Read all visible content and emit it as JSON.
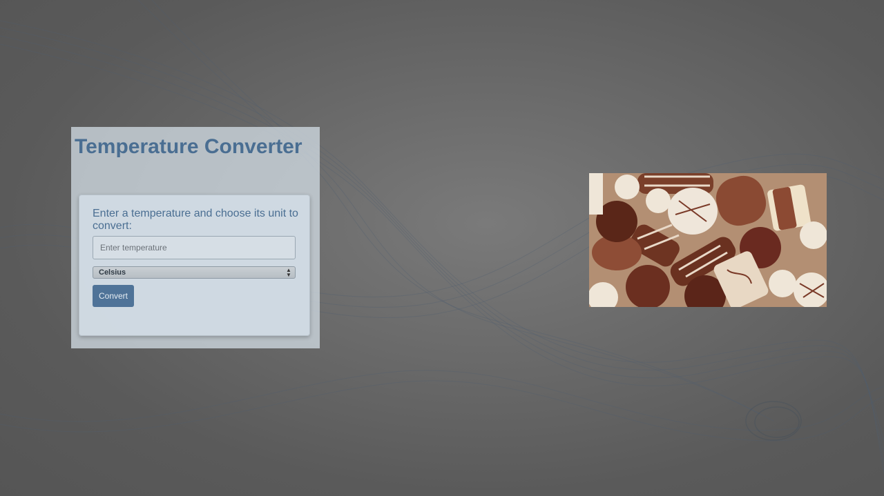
{
  "converter": {
    "title": "Temperature Converter",
    "instruction": "Enter a temperature and choose its unit to convert:",
    "input_placeholder": "Enter temperature",
    "input_value": "",
    "unit_selected": "Celsius",
    "convert_label": "Convert"
  },
  "image": {
    "subject": "assorted chocolate candies"
  },
  "colors": {
    "accent": "#4f7398",
    "title": "#4a6e92",
    "background": "#666666"
  }
}
